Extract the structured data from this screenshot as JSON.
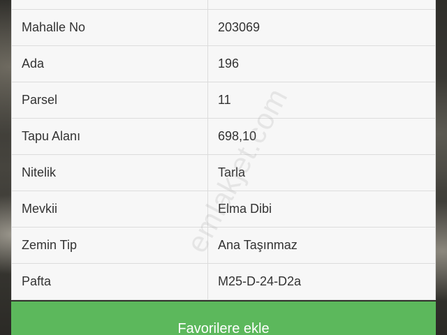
{
  "details": {
    "rows": [
      {
        "label": "",
        "value": ""
      },
      {
        "label": "Mahalle No",
        "value": "203069"
      },
      {
        "label": "Ada",
        "value": "196"
      },
      {
        "label": "Parsel",
        "value": "11"
      },
      {
        "label": "Tapu Alanı",
        "value": "698,10"
      },
      {
        "label": "Nitelik",
        "value": "Tarla"
      },
      {
        "label": "Mevkii",
        "value": "Elma Dibi"
      },
      {
        "label": "Zemin Tip",
        "value": "Ana Taşınmaz"
      },
      {
        "label": "Pafta",
        "value": "M25-D-24-D2a"
      }
    ]
  },
  "actions": {
    "favorite_label": "Favorilere ekle"
  },
  "watermark": "emlakjet.com",
  "colors": {
    "button_green": "#5cb85c",
    "row_background": "#f7f7f7",
    "border": "#dcdcdc"
  }
}
